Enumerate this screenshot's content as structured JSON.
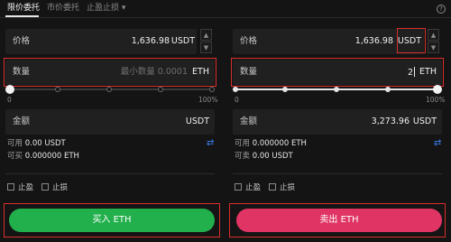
{
  "tabs": {
    "limit": "限价委托",
    "market": "市价委托",
    "stop": "止盈止损",
    "stop_chevron": "▾",
    "help": "?"
  },
  "buy": {
    "price_label": "价格",
    "price_value": "1,636.98",
    "price_unit": "USDT",
    "qty_label": "数量",
    "qty_placeholder": "最小数量 0.0001",
    "qty_unit": "ETH",
    "pct_min": "0",
    "pct_max": "100%",
    "progress": 0,
    "amount_label": "金额",
    "amount_value": "",
    "amount_unit": "USDT",
    "avail_label": "可用",
    "avail_value": "0.00 USDT",
    "can_label": "可买",
    "can_value": "0.000000 ETH",
    "tp_label": "止盈",
    "sl_label": "止损",
    "button": "买入 ETH"
  },
  "sell": {
    "price_label": "价格",
    "price_value": "1,636.98",
    "price_unit": "USDT",
    "qty_label": "数量",
    "qty_value": "2",
    "qty_unit": "ETH",
    "pct_min": "0",
    "pct_max": "100%",
    "progress": 1,
    "amount_label": "金额",
    "amount_value": "3,273.96",
    "amount_unit": "USDT",
    "avail_label": "可用",
    "avail_value": "0.000000 ETH",
    "can_label": "可卖",
    "can_value": "0.00 USDT",
    "tp_label": "止盈",
    "sl_label": "止损",
    "button": "卖出 ETH"
  },
  "icons": {
    "swap": "⇄",
    "up": "▲",
    "down": "▼"
  },
  "colors": {
    "buy": "#21b04b",
    "sell": "#e03564",
    "highlight": "#d6302b",
    "link": "#3b82f6"
  }
}
